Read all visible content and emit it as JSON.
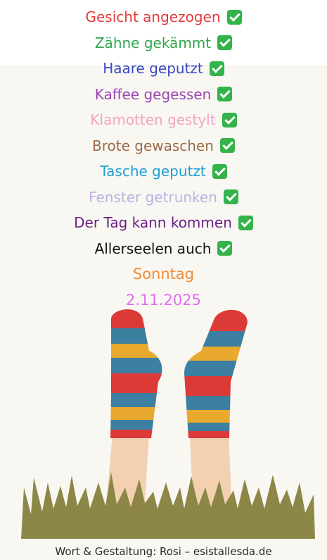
{
  "lines": [
    {
      "text": "Gesicht angezogen",
      "color": "#e53a3a",
      "check": true
    },
    {
      "text": "Zähne gekämmt",
      "color": "#2fa64a",
      "check": true
    },
    {
      "text": "Haare geputzt",
      "color": "#3a47c8",
      "check": true
    },
    {
      "text": "Kaffee gegessen",
      "color": "#9b45b5",
      "check": true
    },
    {
      "text": "Klamotten gestylt",
      "color": "#f4a3c4",
      "check": true
    },
    {
      "text": "Brote gewaschen",
      "color": "#9a6b47",
      "check": true
    },
    {
      "text": "Tasche geputzt",
      "color": "#1e9fd6",
      "check": true
    },
    {
      "text": "Fenster getrunken",
      "color": "#bdb3e3",
      "check": true
    },
    {
      "text": "Der Tag kann kommen",
      "color": "#6b1f86",
      "check": true
    },
    {
      "text": "Allerseelen auch",
      "color": "#111111",
      "check": true
    },
    {
      "text": "Sonntag",
      "color": "#f08c3a",
      "check": false
    },
    {
      "text": "2.11.2025",
      "color": "#e36cf0",
      "check": false
    }
  ],
  "icon": "check-mark-icon",
  "colors": {
    "sock_red": "#dc3a37",
    "sock_blue": "#3d7fa0",
    "sock_yellow": "#e8a92e",
    "skin": "#f2d0b0",
    "grass": "#8c8747"
  },
  "footer": "Wort & Gestaltung: Rosi – esistallesda.de"
}
